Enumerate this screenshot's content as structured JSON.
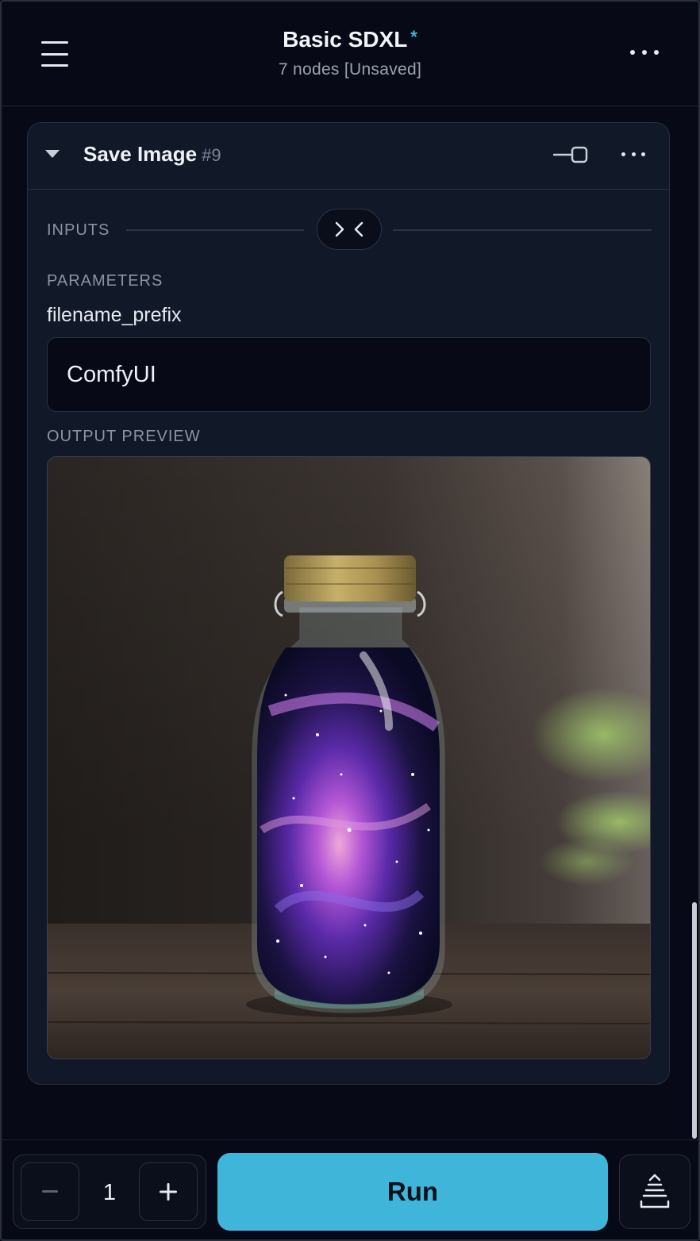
{
  "header": {
    "title": "Basic SDXL",
    "modified_marker": "*",
    "subtitle": "7 nodes [Unsaved]",
    "menu_icon": "hamburger-menu-icon",
    "more_icon": "more-horizontal-icon"
  },
  "node": {
    "title": "Save Image",
    "id": "#9",
    "collapse_icon": "caret-down-icon",
    "pin_icon": "pin-slider-icon",
    "more_icon": "more-horizontal-icon",
    "inputs_label": "INPUTS",
    "collapse_inputs_icon": "collapse-arrows-icon",
    "parameters_label": "PARAMETERS",
    "param_name": "filename_prefix",
    "param_value": "ComfyUI",
    "output_preview_label": "OUTPUT PREVIEW"
  },
  "bottom_bar": {
    "batch_count": "1",
    "minus_label": "−",
    "plus_label": "+",
    "run_label": "Run",
    "queue_icon": "queue-stack-icon"
  },
  "colors": {
    "accent": "#3fb6d9",
    "background": "#070a16",
    "card": "#111827",
    "border": "#283042"
  }
}
